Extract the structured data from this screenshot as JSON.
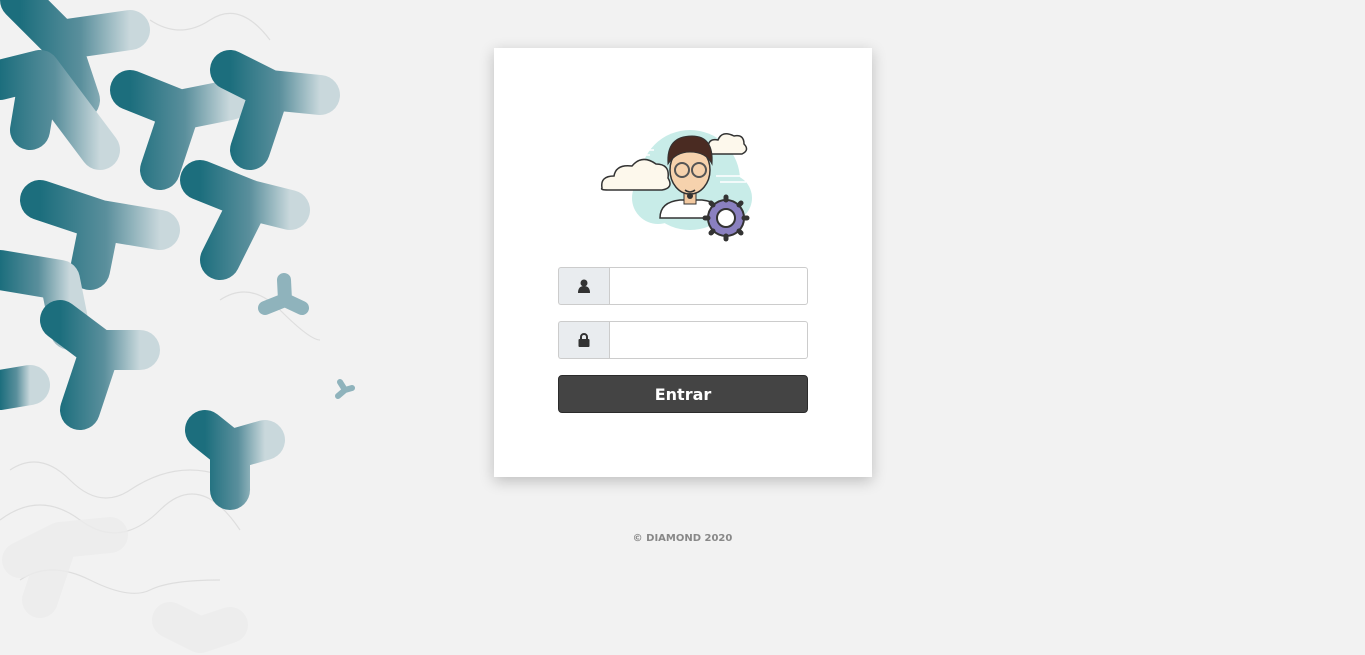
{
  "login": {
    "username_icon": "user-icon",
    "password_icon": "lock-icon",
    "username_value": "",
    "password_value": "",
    "submit_label": "Entrar"
  },
  "footer": {
    "text": "© DIAMOND 2020"
  },
  "colors": {
    "background": "#f2f2f2",
    "pattern_teal": "#1c6e7d",
    "button": "#444444"
  }
}
